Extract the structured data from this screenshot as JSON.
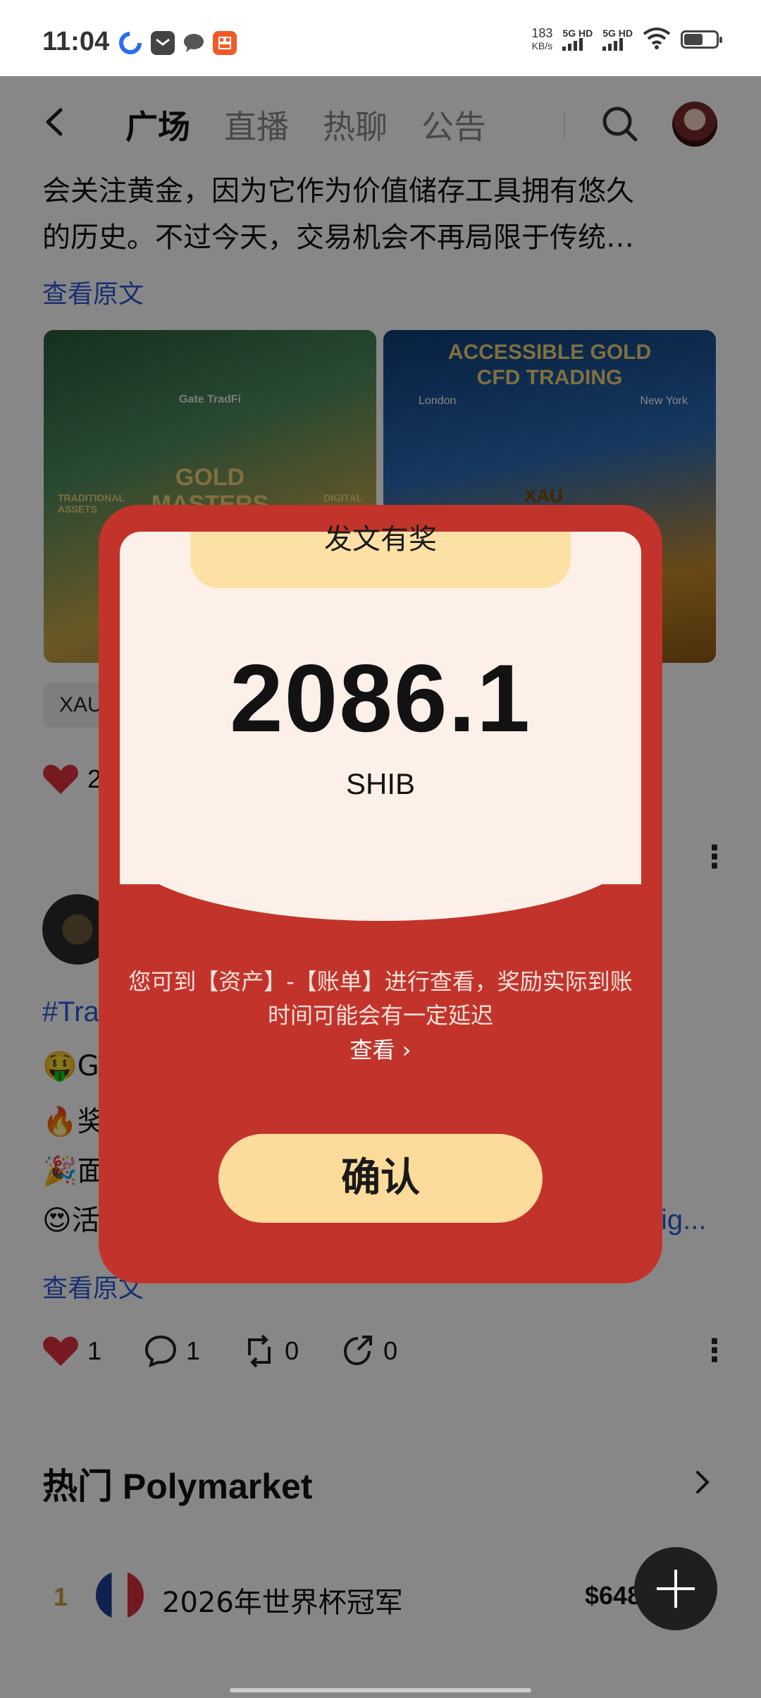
{
  "status_bar": {
    "time": "11:04",
    "speed_value": "183",
    "speed_unit": "KB/s",
    "net1": "5G HD",
    "net2": "5G HD"
  },
  "nav": {
    "tabs": [
      "广场",
      "直播",
      "热聊",
      "公告"
    ],
    "active_tab": "广场"
  },
  "post1": {
    "text_line1": "会关注黄金，因为它作为价值储存工具拥有悠久",
    "text_line2": "的历史。不过今天，交易机会不再局限于传统…",
    "view_original": "查看原文",
    "image_left_caption": "GOLD MASTERS CAMPAIGN",
    "image_left_sub_left": "TRADITIONAL ASSETS",
    "image_left_sub_right": "DIGITAL ASSETS",
    "image_left_brand": "Gate TradFi",
    "image_right_caption": "ACCESSIBLE GOLD CFD TRADING",
    "image_right_city_left": "London",
    "image_right_city_right": "New York",
    "image_right_coin": "XAU",
    "tag_chip": "XAU",
    "likes": "2"
  },
  "post2": {
    "hashtag": "#Tra",
    "emoji_lines": [
      "🤑G",
      "🔥奖",
      "🎉面",
      "😍活"
    ],
    "link_fragment": "ig...",
    "view_original": "查看原文",
    "likes": "1",
    "comments": "1",
    "reposts": "0",
    "shares": "0"
  },
  "polymarket": {
    "title": "热门 Polymarket",
    "rows": [
      {
        "rank": "1",
        "name": "2026年世界杯冠军",
        "price": "$648"
      }
    ]
  },
  "modal": {
    "title": "发文有奖",
    "amount": "2086.1",
    "unit": "SHIB",
    "desc": "您可到【资产】-【账单】进行查看，奖励实际到账时间可能会有一定延迟",
    "view_link": "查看 ›",
    "confirm": "确认"
  },
  "colors": {
    "modal_red": "#c2342b",
    "modal_card": "#fcf0e8",
    "accent_gold": "#fddb9b",
    "link_blue": "#2d5bd8",
    "like_red": "#e0303f"
  }
}
